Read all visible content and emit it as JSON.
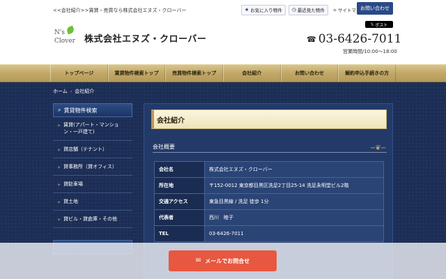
{
  "header": {
    "tagline": "<<会社紹介>>賃貸・売買なら株式会社エヌズ・クローバー",
    "logo_line1": "N's",
    "logo_line2": "Clover",
    "company_name": "株式会社エヌズ・クローバー",
    "favorites_label": "お気に入り物件",
    "recent_label": "最近見た物件",
    "sitemap_label": "サイトマップ",
    "contact_label": "お問い合わせ",
    "post_label": "ポスト",
    "phone": "03-6426-7011",
    "hours": "営業時間/10:00〜18:00"
  },
  "nav": {
    "items": [
      "トップページ",
      "賃貸物件検索トップ",
      "売買物件検索トップ",
      "会社紹介",
      "お問い合わせ",
      "解約申込手続きの方"
    ]
  },
  "breadcrumb": {
    "home": "ホーム",
    "current": "会社紹介"
  },
  "sidebar": {
    "heading": "賃貸物件検索",
    "items": [
      "賃貸(アパート・マンション・一戸建て)",
      "貸店舗（テナント）",
      "貸事務所（貸オフィス）",
      "貸駐車場",
      "貸土地",
      "貸ビル・貸倉庫・その他"
    ]
  },
  "content": {
    "title": "会社紹介",
    "section_title": "会社概要",
    "rows": [
      {
        "label": "会社名",
        "value": "株式会社エヌズ・クローバー"
      },
      {
        "label": "所在地",
        "value": "〒152-0012 東京都目黒区洗足2丁目25-14 洗足永明堂ビル2階"
      },
      {
        "label": "交通アクセス",
        "value": "東急目黒線 / 洗足 徒歩 1分"
      },
      {
        "label": "代表者",
        "value": "西川　睦子"
      },
      {
        "label": "TEL",
        "value": "03-6426-7011"
      }
    ]
  },
  "footer_cta": {
    "mail_label": "メールでお問合せ"
  },
  "colors": {
    "navy": "#1c2e56",
    "gold": "#c2a868",
    "cta": "#e8573f"
  }
}
